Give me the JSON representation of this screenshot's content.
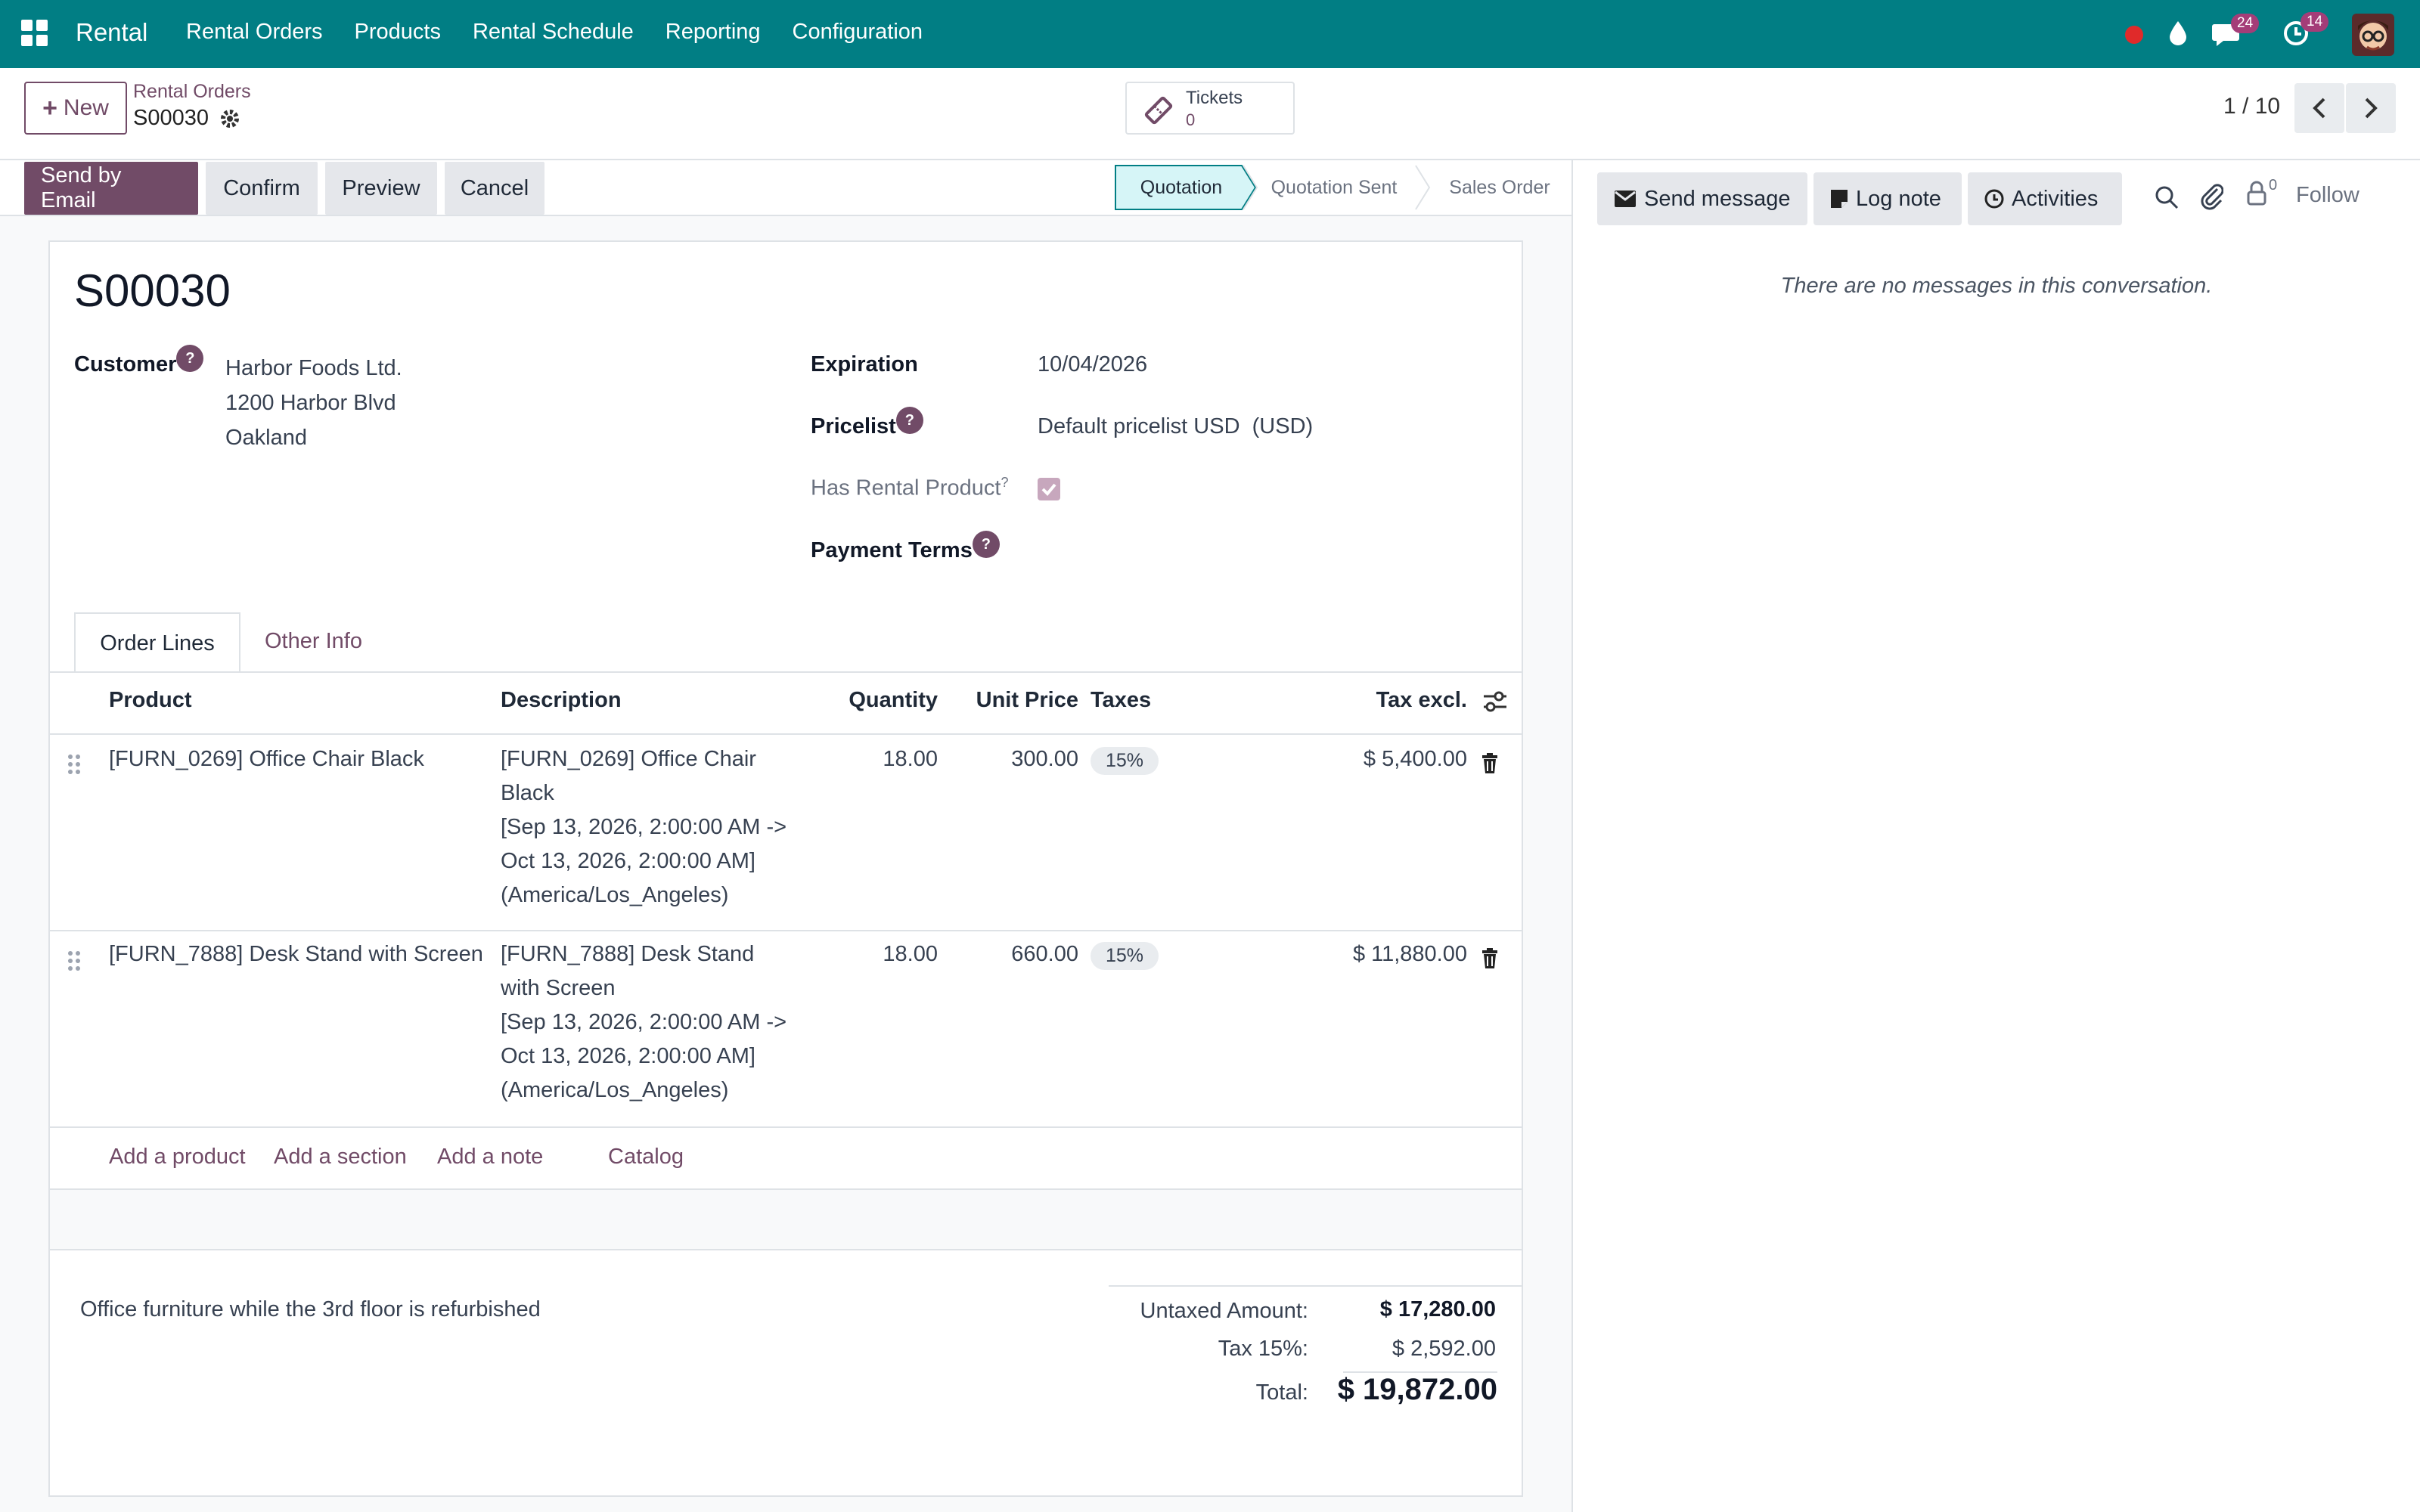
{
  "nav": {
    "brand": "Rental",
    "menu": [
      "Rental Orders",
      "Products",
      "Rental Schedule",
      "Reporting",
      "Configuration"
    ],
    "messages_count": "24",
    "activities_count": "14"
  },
  "control": {
    "new_label": "New",
    "breadcrumb_parent": "Rental Orders",
    "breadcrumb_current": "S00030",
    "tickets_label": "Tickets",
    "tickets_count": "0",
    "pager": "1 / 10"
  },
  "actions": {
    "send_email": "Send by Email",
    "confirm": "Confirm",
    "preview": "Preview",
    "cancel": "Cancel"
  },
  "statusbar": {
    "stages": [
      "Quotation",
      "Quotation Sent",
      "Sales Order"
    ],
    "active": "Quotation"
  },
  "form": {
    "title": "S00030",
    "customer_label": "Customer",
    "customer_lines": [
      "Harbor Foods Ltd.",
      "1200 Harbor Blvd",
      "Oakland"
    ],
    "expiration_label": "Expiration",
    "expiration_value": "10/04/2026",
    "pricelist_label": "Pricelist",
    "pricelist_value": "Default pricelist USD  (USD)",
    "has_rental_label": "Has Rental Product",
    "has_rental_checked": true,
    "payment_terms_label": "Payment Terms",
    "help_mark": "?"
  },
  "tabs": [
    "Order Lines",
    "Other Info"
  ],
  "table": {
    "headers": [
      "Product",
      "Description",
      "Quantity",
      "Unit Price",
      "Taxes",
      "Tax excl."
    ],
    "rows": [
      {
        "product": "[FURN_0269] Office Chair Black",
        "description": [
          "[FURN_0269] Office Chair",
          "Black",
          "[Sep 13, 2026, 2:00:00 AM ->",
          "Oct 13, 2026, 2:00:00 AM]",
          "(America/Los_Angeles)"
        ],
        "quantity": "18.00",
        "unit_price": "300.00",
        "tax": "15%",
        "subtotal": "$ 5,400.00"
      },
      {
        "product": "[FURN_7888] Desk Stand with Screen",
        "description": [
          "[FURN_7888] Desk Stand",
          "with Screen",
          "[Sep 13, 2026, 2:00:00 AM ->",
          "Oct 13, 2026, 2:00:00 AM]",
          "(America/Los_Angeles)"
        ],
        "quantity": "18.00",
        "unit_price": "660.00",
        "tax": "15%",
        "subtotal": "$ 11,880.00"
      }
    ],
    "add_links": [
      "Add a product",
      "Add a section",
      "Add a note",
      "Catalog"
    ]
  },
  "note": "Office furniture while the 3rd floor is refurbished",
  "totals": {
    "untaxed_label": "Untaxed Amount:",
    "untaxed_value": "$ 17,280.00",
    "tax_label": "Tax 15%:",
    "tax_value": "$ 2,592.00",
    "total_label": "Total:",
    "total_value": "$ 19,872.00"
  },
  "chatter": {
    "send_message": "Send message",
    "log_note": "Log note",
    "activities": "Activities",
    "followers_count": "0",
    "follow": "Follow",
    "empty": "There are no messages in this conversation."
  }
}
